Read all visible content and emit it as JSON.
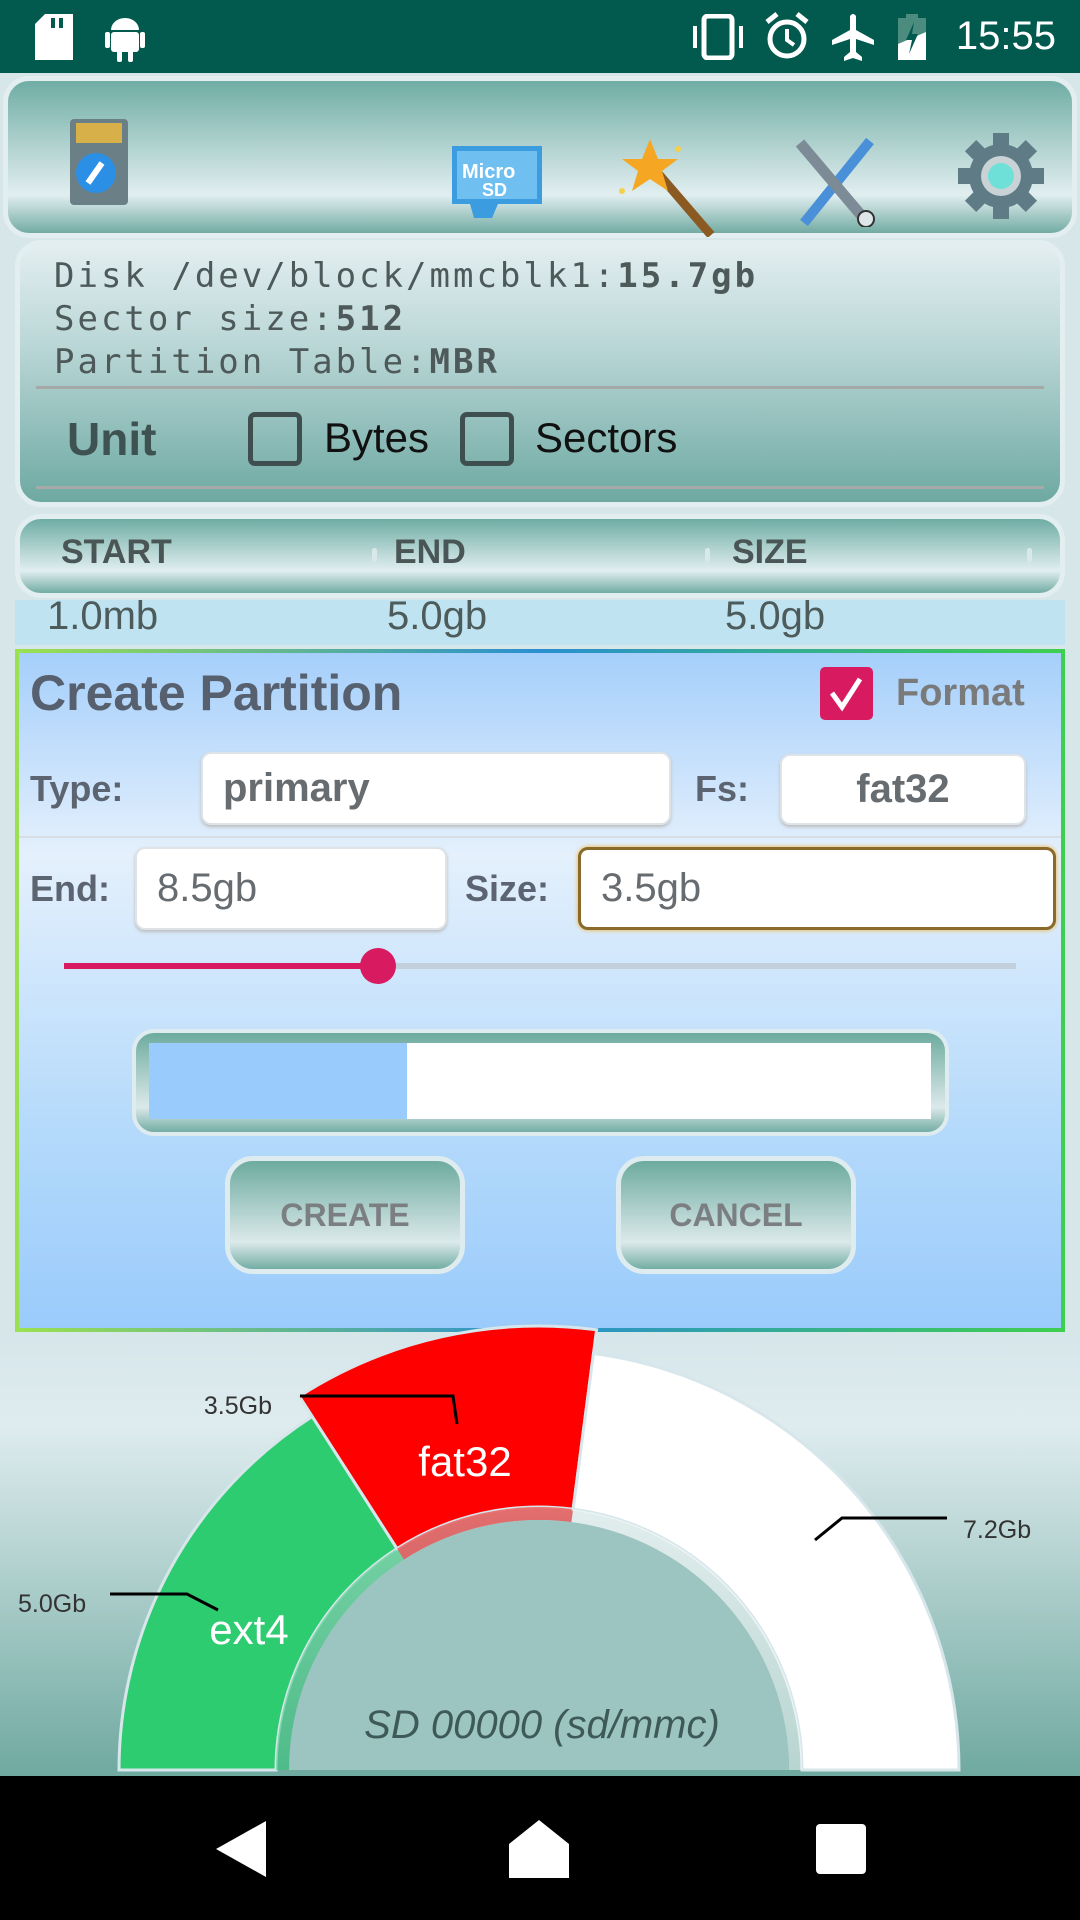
{
  "status_bar": {
    "time": "15:55",
    "icons": [
      "sd-card-icon",
      "android-icon",
      "vibrate-icon",
      "alarm-icon",
      "airplane-icon",
      "battery-charging-icon"
    ]
  },
  "toolbar": {
    "icons": [
      "sd-edit-icon",
      "microsd-icon",
      "magic-wand-icon",
      "tools-icon",
      "settings-gear-icon"
    ]
  },
  "disk_info": {
    "disk_label": "Disk /dev/block/mmcblk1:",
    "disk_size": "15.7gb",
    "sector_label": "Sector size:",
    "sector_size": "512",
    "table_label": "Partition Table:",
    "table_type": "MBR"
  },
  "unit": {
    "label": "Unit",
    "bytes": "Bytes",
    "bytes_checked": false,
    "sectors": "Sectors",
    "sectors_checked": false
  },
  "partition_table": {
    "columns": [
      "START",
      "END",
      "SIZE"
    ],
    "rows": [
      [
        "1.0mb",
        "5.0gb",
        "5.0gb"
      ]
    ]
  },
  "create_partition": {
    "title": "Create Partition",
    "format_label": "Format",
    "format_checked": true,
    "type_label": "Type:",
    "type_value": "primary",
    "fs_label": "Fs:",
    "fs_value": "fat32",
    "end_label": "End:",
    "end_value": "8.5gb",
    "size_label": "Size:",
    "size_value": "3.5gb",
    "slider_fraction": 0.33,
    "progress_fraction": 0.33,
    "create_label": "CREATE",
    "cancel_label": "CANCEL",
    "accent": "#d81b60"
  },
  "chart_data": {
    "type": "pie",
    "shape": "half-donut",
    "center_label": "SD 00000 (sd/mmc)",
    "total": 15.7,
    "slices": [
      {
        "name": "ext4",
        "value": 5.0,
        "value_label": "5.0Gb",
        "color": "#2ecc71",
        "label_color": "#ffffff"
      },
      {
        "name": "fat32",
        "value": 3.5,
        "value_label": "3.5Gb",
        "color": "#ff0000",
        "label_color": "#ffffff",
        "highlighted": true
      },
      {
        "name": "",
        "value": 7.2,
        "value_label": "7.2Gb",
        "color": "#ffffff"
      }
    ]
  },
  "nav_bar": {
    "icons": [
      "back-icon",
      "home-icon",
      "recents-icon"
    ]
  }
}
